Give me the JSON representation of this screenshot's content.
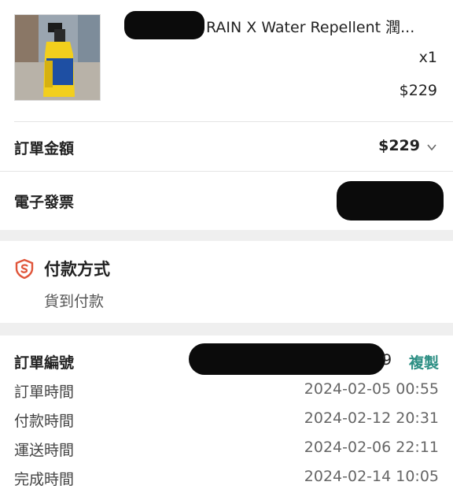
{
  "product": {
    "name": "RAIN X Water Repellent 潤...",
    "quantity": "x1",
    "price": "$229",
    "thumb_label": "rain-x"
  },
  "order_total": {
    "label": "訂單金額",
    "value": "$229"
  },
  "invoice": {
    "label": "電子發票"
  },
  "payment": {
    "title": "付款方式",
    "method": "貨到付款",
    "accent": "#e0553a"
  },
  "order_info": {
    "number_label": "訂單編號",
    "number_tail": "9",
    "copy_label": "複製",
    "copy_color": "#2d8f84",
    "rows": [
      {
        "label": "訂單時間",
        "value": "2024-02-05 00:55"
      },
      {
        "label": "付款時間",
        "value": "2024-02-12 20:31"
      },
      {
        "label": "運送時間",
        "value": "2024-02-06 22:11"
      },
      {
        "label": "完成時間",
        "value": "2024-02-14 10:05"
      }
    ]
  }
}
